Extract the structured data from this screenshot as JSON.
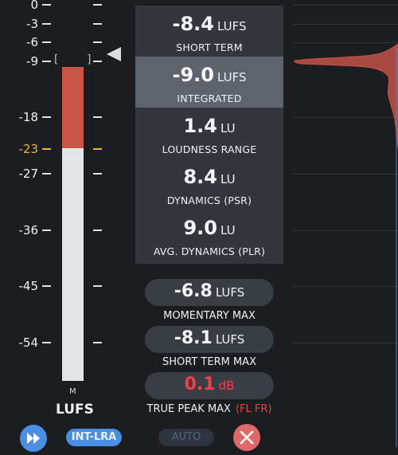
{
  "scale": {
    "ticks": [
      {
        "label": "0"
      },
      {
        "label": "-3"
      },
      {
        "label": "-6"
      },
      {
        "label": "-9"
      },
      {
        "label": "-18"
      },
      {
        "label": "-23",
        "highlight": true
      },
      {
        "label": "-27"
      },
      {
        "label": "-36"
      },
      {
        "label": "-45"
      },
      {
        "label": "-54"
      }
    ],
    "channel_label": "M",
    "unit_label": "LUFS",
    "meter_level_lufs": -9.0,
    "target_lufs": -23
  },
  "readouts": [
    {
      "value": "-8.4",
      "unit": "LUFS",
      "caption": "SHORT TERM",
      "active": false
    },
    {
      "value": "-9.0",
      "unit": "LUFS",
      "caption": "INTEGRATED",
      "active": true
    },
    {
      "value": "1.4",
      "unit": "LU",
      "caption": "LOUDNESS RANGE",
      "active": false
    },
    {
      "value": "8.4",
      "unit": "LU",
      "caption": "DYNAMICS (PSR)",
      "active": false
    },
    {
      "value": "9.0",
      "unit": "LU",
      "caption": "AVG. DYNAMICS (PLR)",
      "active": false
    }
  ],
  "max_readouts": [
    {
      "value": "-6.8",
      "unit": "LUFS",
      "caption": "MOMENTARY MAX"
    },
    {
      "value": "-8.1",
      "unit": "LUFS",
      "caption": "SHORT TERM MAX"
    },
    {
      "value": "0.1",
      "unit": "dB",
      "caption": "TRUE PEAK MAX",
      "channels": "(FL FR)",
      "alert": true
    }
  ],
  "buttons": {
    "play_icon": "fast-forward-icon",
    "int_lra": "INT-LRA",
    "auto": "AUTO",
    "close_icon": "close-icon"
  },
  "colors": {
    "meter_fill": "#c95548",
    "target": "#e8b43c",
    "accent": "#4a8ee6",
    "alert": "#f2404a"
  }
}
